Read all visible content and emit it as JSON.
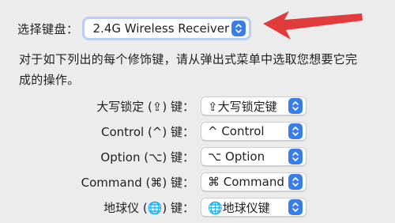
{
  "keyboard": {
    "label": "选择键盘：",
    "selected": "2.4G Wireless Receiver"
  },
  "description": "对于如下列出的每个修饰键，请从弹出式菜单中选取您想要它完成的操作。",
  "modifiers": [
    {
      "label": "大写锁定 (⇪) 键：",
      "value": "⇪大写锁定键"
    },
    {
      "label": "Control (^) 键：",
      "value": "^ Control"
    },
    {
      "label": "Option (⌥) 键：",
      "value": "⌥ Option"
    },
    {
      "label": "Command (⌘) 键：",
      "value": "⌘ Command"
    },
    {
      "label": "地球仪 (🌐) 键：",
      "value": "🌐地球仪键"
    }
  ],
  "colors": {
    "accent": "#3b7de8",
    "arrow": "#e23b3b",
    "background": "#ececec"
  },
  "icons": {
    "stepper": "up-down-chevron-icon",
    "annotation": "red-arrow-icon"
  }
}
